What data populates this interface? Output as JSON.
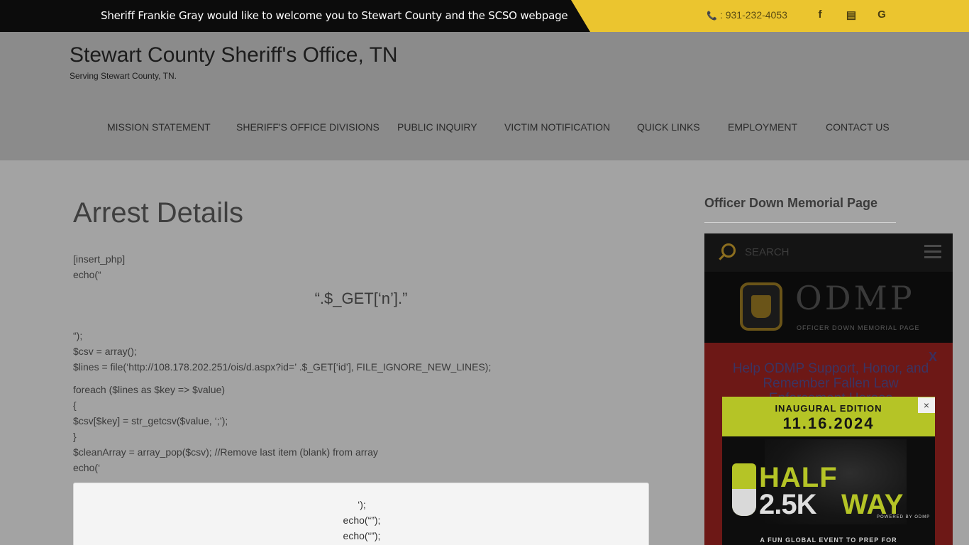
{
  "topbar": {
    "welcome": "Sheriff Frankie Gray would like to welcome you to Stewart County and the SCSO webpage",
    "phone": ": 931-232-4053",
    "social": [
      {
        "icon": "facebook-icon",
        "glyph": "f"
      },
      {
        "icon": "newspaper-icon",
        "glyph": "▤"
      },
      {
        "icon": "google-icon",
        "glyph": "G"
      }
    ]
  },
  "site": {
    "title": "Stewart County Sheriff's Office, TN",
    "tagline": "Serving Stewart County, TN."
  },
  "nav": [
    {
      "label": "MISSION STATEMENT"
    },
    {
      "label": "SHERIFF'S OFFICE DIVISIONS"
    },
    {
      "label": "PUBLIC INQUIRY"
    },
    {
      "label": "VICTIM NOTIFICATION"
    },
    {
      "label": "QUICK LINKS"
    },
    {
      "label": "EMPLOYMENT"
    },
    {
      "label": "CONTACT US"
    }
  ],
  "main": {
    "heading": "Arrest Details",
    "lines_a": [
      "[insert_php]",
      "echo(“"
    ],
    "center_big": "“.$_GET[‘n’].”",
    "lines_b": [
      "“);",
      "$csv = array();",
      "$lines = file(‘http://108.178.202.251/ois/d.aspx?id=’ .$_GET[‘id’], FILE_IGNORE_NEW_LINES);",
      "foreach ($lines as $key => $value)",
      "{",
      "$csv[$key] = str_getcsv($value, ‘;’);",
      "}",
      "$cleanArray = array_pop($csv); //Remove last item (blank) from array",
      "echo(‘"
    ],
    "box_lines": [
      "‘);",
      "echo(“”);",
      "echo(“”);"
    ]
  },
  "sidebar": {
    "widget_title": "Officer Down Memorial Page",
    "odmp": {
      "search_placeholder": "SEARCH",
      "logo_word": "ODMP",
      "logo_sub": "OFFICER DOWN MEMORIAL PAGE",
      "close": "X",
      "help_text": "Help ODMP Support, Honor, and Remember Fallen Law Enforcement Heroes"
    }
  },
  "ad": {
    "line1": "INAUGURAL EDITION",
    "line2": "11.16.2024",
    "half": "HALF",
    "k": "2.5K",
    "way": "WAY",
    "powered": "POWERED BY ODMP",
    "bottom": "A FUN GLOBAL EVENT TO PREP FOR",
    "close": "×"
  }
}
